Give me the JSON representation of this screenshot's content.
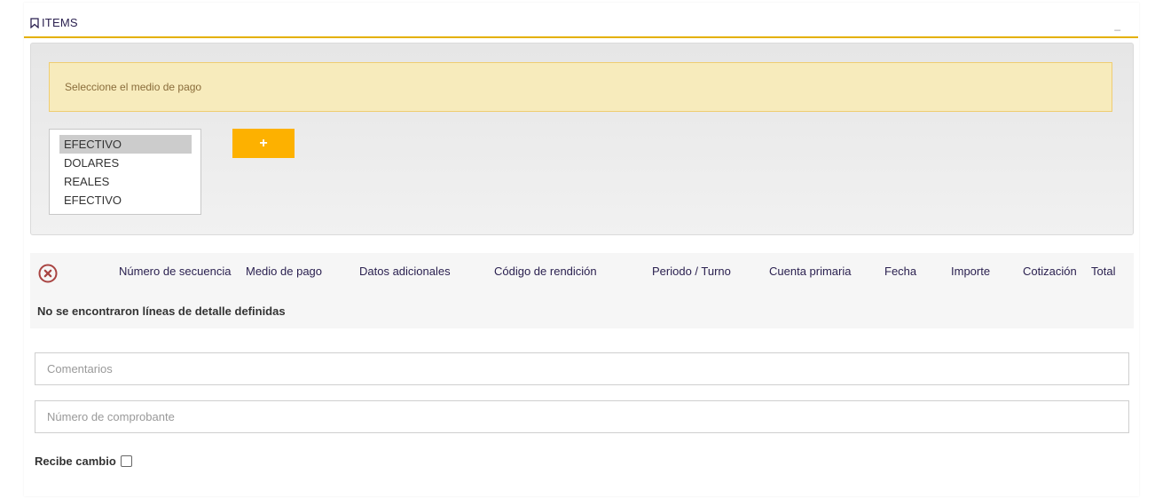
{
  "section": {
    "title": "ITEMS",
    "collapse_glyph": "_"
  },
  "payment_selector": {
    "alert_text": "Seleccione el medio de pago",
    "options": [
      "EFECTIVO",
      "DOLARES",
      "REALES",
      "EFECTIVO"
    ],
    "selected_index": 0,
    "add_button_label": "+"
  },
  "table": {
    "columns": [
      "Número de secuencia",
      "Medio de pago",
      "Datos adicionales",
      "Código de rendición",
      "Periodo / Turno",
      "Cuenta primaria",
      "Fecha",
      "Importe",
      "Cotización",
      "Total"
    ],
    "empty_message": "No se encontraron líneas de detalle definidas"
  },
  "form": {
    "comments_placeholder": "Comentarios",
    "voucher_placeholder": "Número de comprobante",
    "change_label": "Recibe cambio"
  },
  "icons": {
    "title_icon": "bookmark-icon",
    "delete_icon": "delete-circle-icon"
  },
  "colors": {
    "accent": "#fdb100",
    "header_underline": "#e4b000",
    "alert_bg": "#f7ebbc",
    "alert_text": "#8a6d3b",
    "delete_icon": "#a94442"
  }
}
